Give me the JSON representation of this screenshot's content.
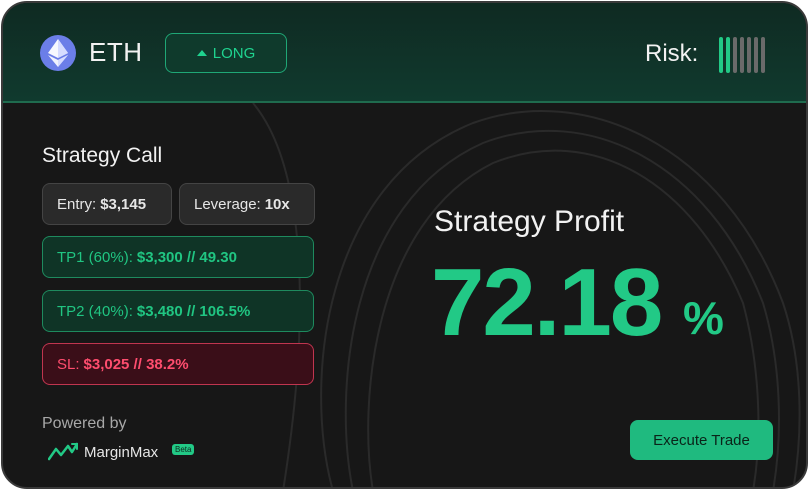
{
  "header": {
    "asset": "ETH",
    "asset_icon": "ethereum-icon",
    "direction_label": "LONG",
    "direction_icon": "triangle-up-icon",
    "risk_label": "Risk:",
    "risk_level": 2,
    "risk_max": 7
  },
  "strategy": {
    "title": "Strategy Call",
    "entry": {
      "label": "Entry:",
      "value": "$3,145"
    },
    "leverage": {
      "label": "Leverage:",
      "value": "10x"
    },
    "tp1": {
      "label": "TP1 (60%):",
      "value": "$3,300 // 49.30"
    },
    "tp2": {
      "label": "TP2 (40%):",
      "value": "$3,480 // 106.5%"
    },
    "sl": {
      "label": "SL:",
      "value": "$3,025 // 38.2%"
    }
  },
  "profit": {
    "label": "Strategy Profit",
    "value": "72.18",
    "unit": "%"
  },
  "footer": {
    "powered_by": "Powered by",
    "brand": "MarginMax",
    "badge": "Beta",
    "brand_icon": "marginmax-logo-icon",
    "execute_label": "Execute Trade"
  },
  "colors": {
    "accent": "#22c986",
    "danger": "#ff4d6e",
    "card_bg": "#171717",
    "header_bg": "#103a2e"
  }
}
